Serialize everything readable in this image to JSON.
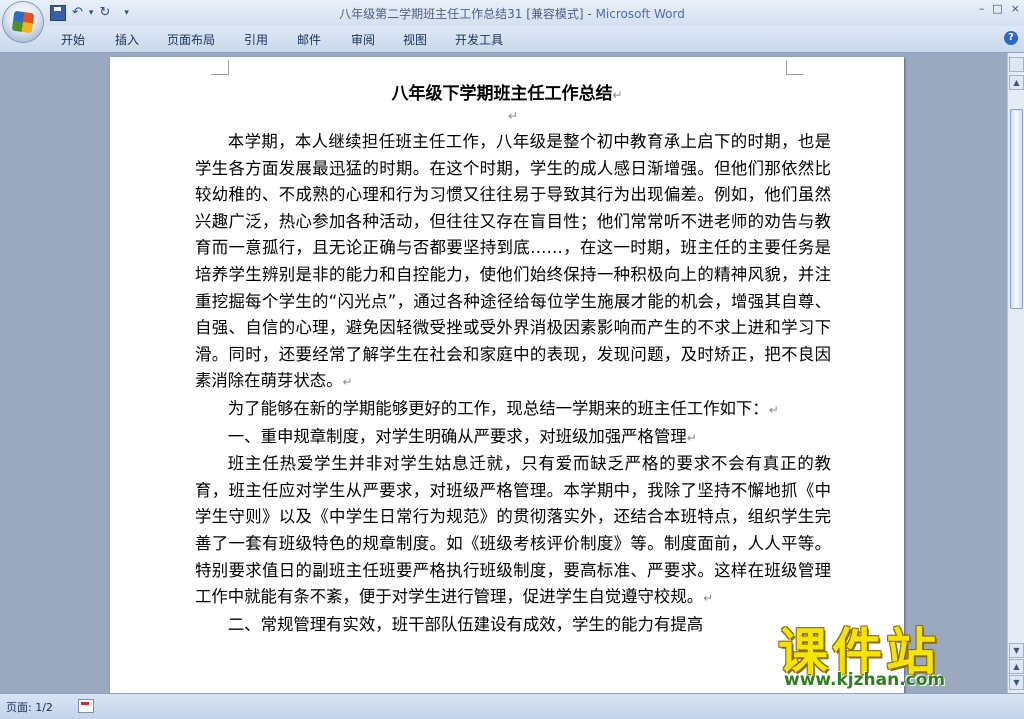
{
  "window": {
    "title": "八年级第二学期班主任工作总结31 [兼容模式] - ",
    "app_name": "Microsoft Word",
    "minimize": "–",
    "maximize": "□",
    "close": "×"
  },
  "qat": {
    "undo": "↶",
    "redo": "↻",
    "dropdown": "▾"
  },
  "ribbon": {
    "tabs": [
      "开始",
      "插入",
      "页面布局",
      "引用",
      "邮件",
      "审阅",
      "视图",
      "开发工具"
    ],
    "help": "?"
  },
  "document": {
    "title": "八年级下学期班主任工作总结",
    "para_mark": "↵",
    "paragraphs": [
      "本学期，本人继续担任班主任工作，八年级是整个初中教育承上启下的时期，也是学生各方面发展最迅猛的时期。在这个时期，学生的成人感日渐增强。但他们那依然比较幼稚的、不成熟的心理和行为习惯又往往易于导致其行为出现偏差。例如，他们虽然兴趣广泛，热心参加各种活动，但往往又存在盲目性；他们常常听不进老师的劝告与教育而一意孤行，且无论正确与否都要坚持到底……，在这一时期，班主任的主要任务是培养学生辨别是非的能力和自控能力，使他们始终保持一种积极向上的精神风貌，并注重挖掘每个学生的“闪光点”，通过各种途径给每位学生施展才能的机会，增强其自尊、自强、自信的心理，避免因轻微受挫或受外界消极因素影响而产生的不求上进和学习下滑。同时，还要经常了解学生在社会和家庭中的表现，发现问题，及时矫正，把不良因素消除在萌芽状态。",
      "为了能够在新的学期能够更好的工作，现总结一学期来的班主任工作如下：",
      "一、重申规章制度，对学生明确从严要求，对班级加强严格管理",
      "班主任热爱学生并非对学生姑息迁就，只有爱而缺乏严格的要求不会有真正的教育，班主任应对学生从严要求，对班级严格管理。本学期中，我除了坚持不懈地抓《中学生守则》以及《中学生日常行为规范》的贯彻落实外，还结合本班特点，组织学生完善了一套有班级特色的规章制度。如《班级考核评价制度》等。制度面前，人人平等。特别要求值日的副班主任班要严格执行班级制度，要高标准、严要求。这样在班级管理工作中就能有条不紊，便于对学生进行管理，促进学生自觉遵守校规。",
      "二、常规管理有实效，班干部队伍建设有成效，学生的能力有提高"
    ]
  },
  "statusbar": {
    "page_info": "页面: 1/2"
  },
  "watermark": {
    "brand": "课件站",
    "url": "www.kjzhan.com"
  }
}
